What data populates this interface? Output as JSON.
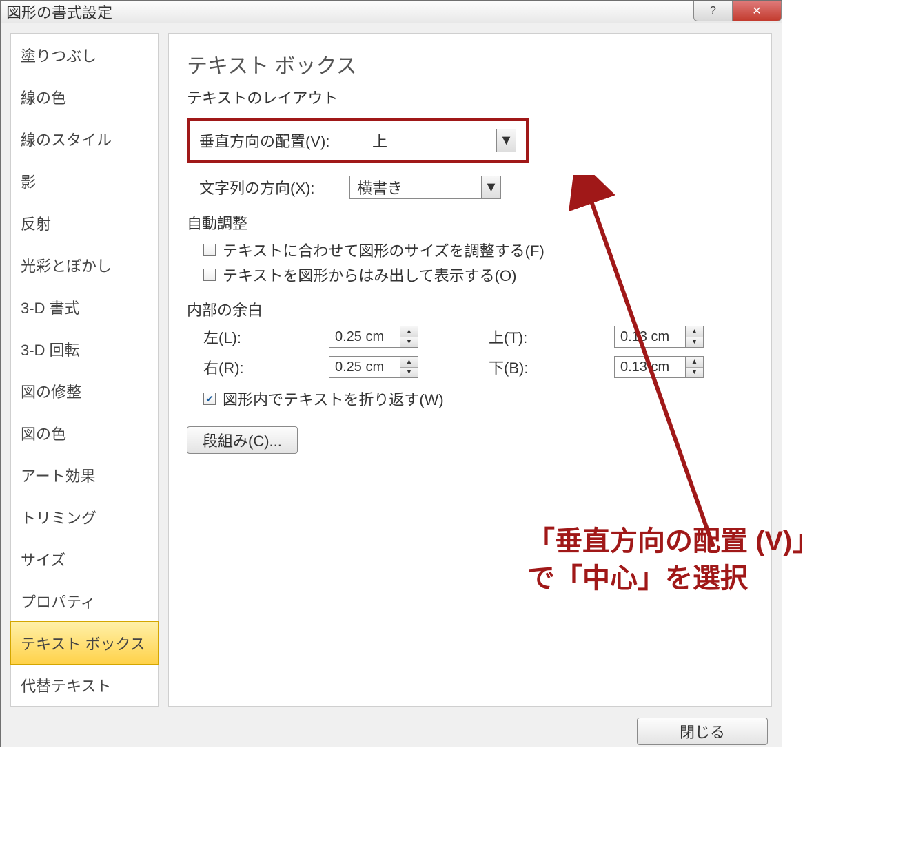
{
  "title": "図形の書式設定",
  "sidebar": {
    "items": [
      {
        "label": "塗りつぶし"
      },
      {
        "label": "線の色"
      },
      {
        "label": "線のスタイル"
      },
      {
        "label": "影"
      },
      {
        "label": "反射"
      },
      {
        "label": "光彩とぼかし"
      },
      {
        "label": "3-D 書式"
      },
      {
        "label": "3-D 回転"
      },
      {
        "label": "図の修整"
      },
      {
        "label": "図の色"
      },
      {
        "label": "アート効果"
      },
      {
        "label": "トリミング"
      },
      {
        "label": "サイズ"
      },
      {
        "label": "プロパティ"
      },
      {
        "label": "テキスト ボックス"
      },
      {
        "label": "代替テキスト"
      }
    ],
    "selected_index": 14
  },
  "panel": {
    "heading": "テキスト ボックス",
    "layout_section": "テキストのレイアウト",
    "valign_label": "垂直方向の配置(V):",
    "valign_value": "上",
    "textdir_label": "文字列の方向(X):",
    "textdir_value": "横書き",
    "autofit_section": "自動調整",
    "autofit1": "テキストに合わせて図形のサイズを調整する(F)",
    "autofit2": "テキストを図形からはみ出して表示する(O)",
    "margins_section": "内部の余白",
    "left_label": "左(L):",
    "left_value": "0.25 cm",
    "right_label": "右(R):",
    "right_value": "0.25 cm",
    "top_label": "上(T):",
    "top_value": "0.13 cm",
    "bottom_label": "下(B):",
    "bottom_value": "0.13 cm",
    "wrap_label": "図形内でテキストを折り返す(W)",
    "columns_btn": "段組み(C)..."
  },
  "footer": {
    "close": "閉じる"
  },
  "annotation": {
    "line1": "「垂直方向の配置 (V)」",
    "line2": "で「中心」を選択"
  }
}
